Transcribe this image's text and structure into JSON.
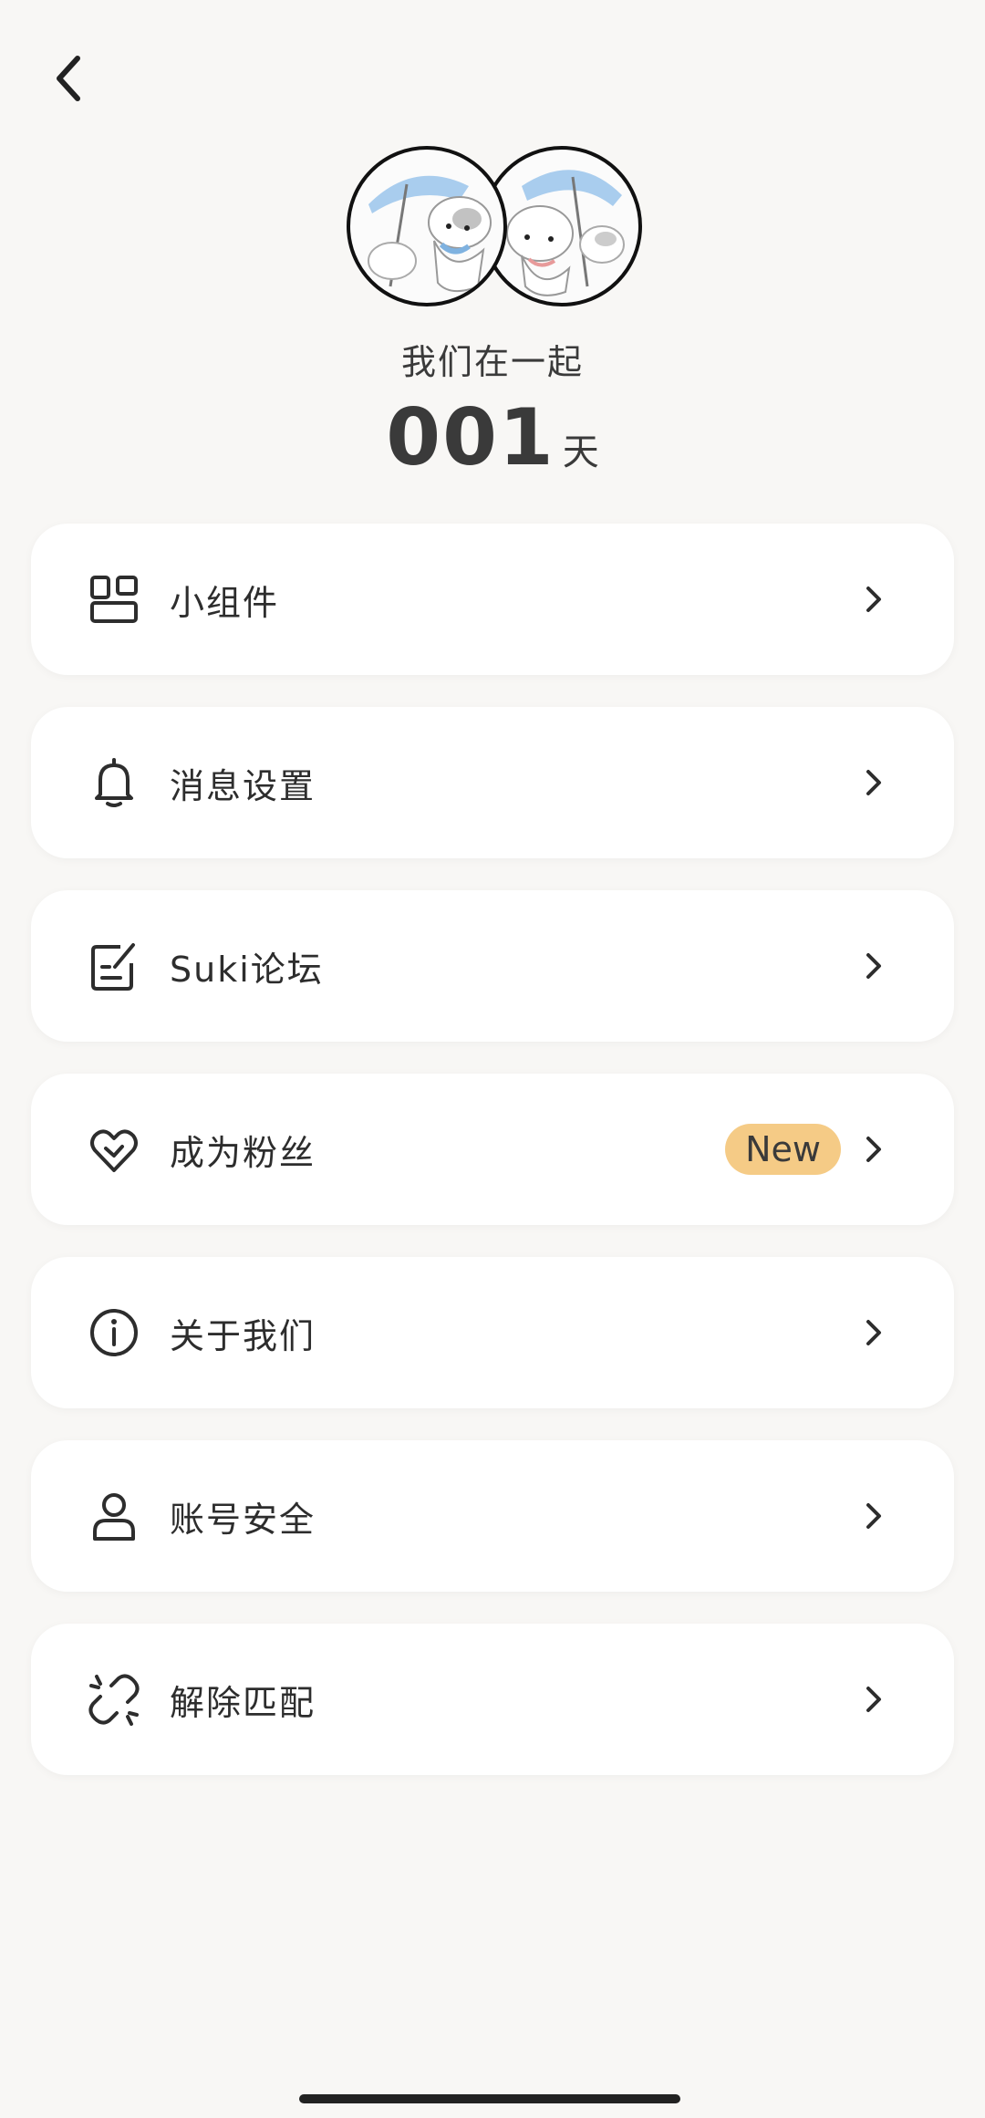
{
  "header": {
    "together_label": "我们在一起",
    "days_count": "001",
    "days_unit": "天"
  },
  "menu": {
    "items": [
      {
        "label": "小组件",
        "icon": "widget-icon"
      },
      {
        "label": "消息设置",
        "icon": "bell-icon"
      },
      {
        "label": "Suki论坛",
        "icon": "forum-edit-icon"
      },
      {
        "label": "成为粉丝",
        "icon": "heart-check-icon",
        "badge": "New"
      },
      {
        "label": "关于我们",
        "icon": "info-icon"
      },
      {
        "label": "账号安全",
        "icon": "user-icon"
      },
      {
        "label": "解除匹配",
        "icon": "unlink-icon"
      }
    ]
  },
  "colors": {
    "background": "#f8f7f5",
    "card": "#ffffff",
    "badge": "#f5cb86",
    "text": "#2d2d2d"
  }
}
